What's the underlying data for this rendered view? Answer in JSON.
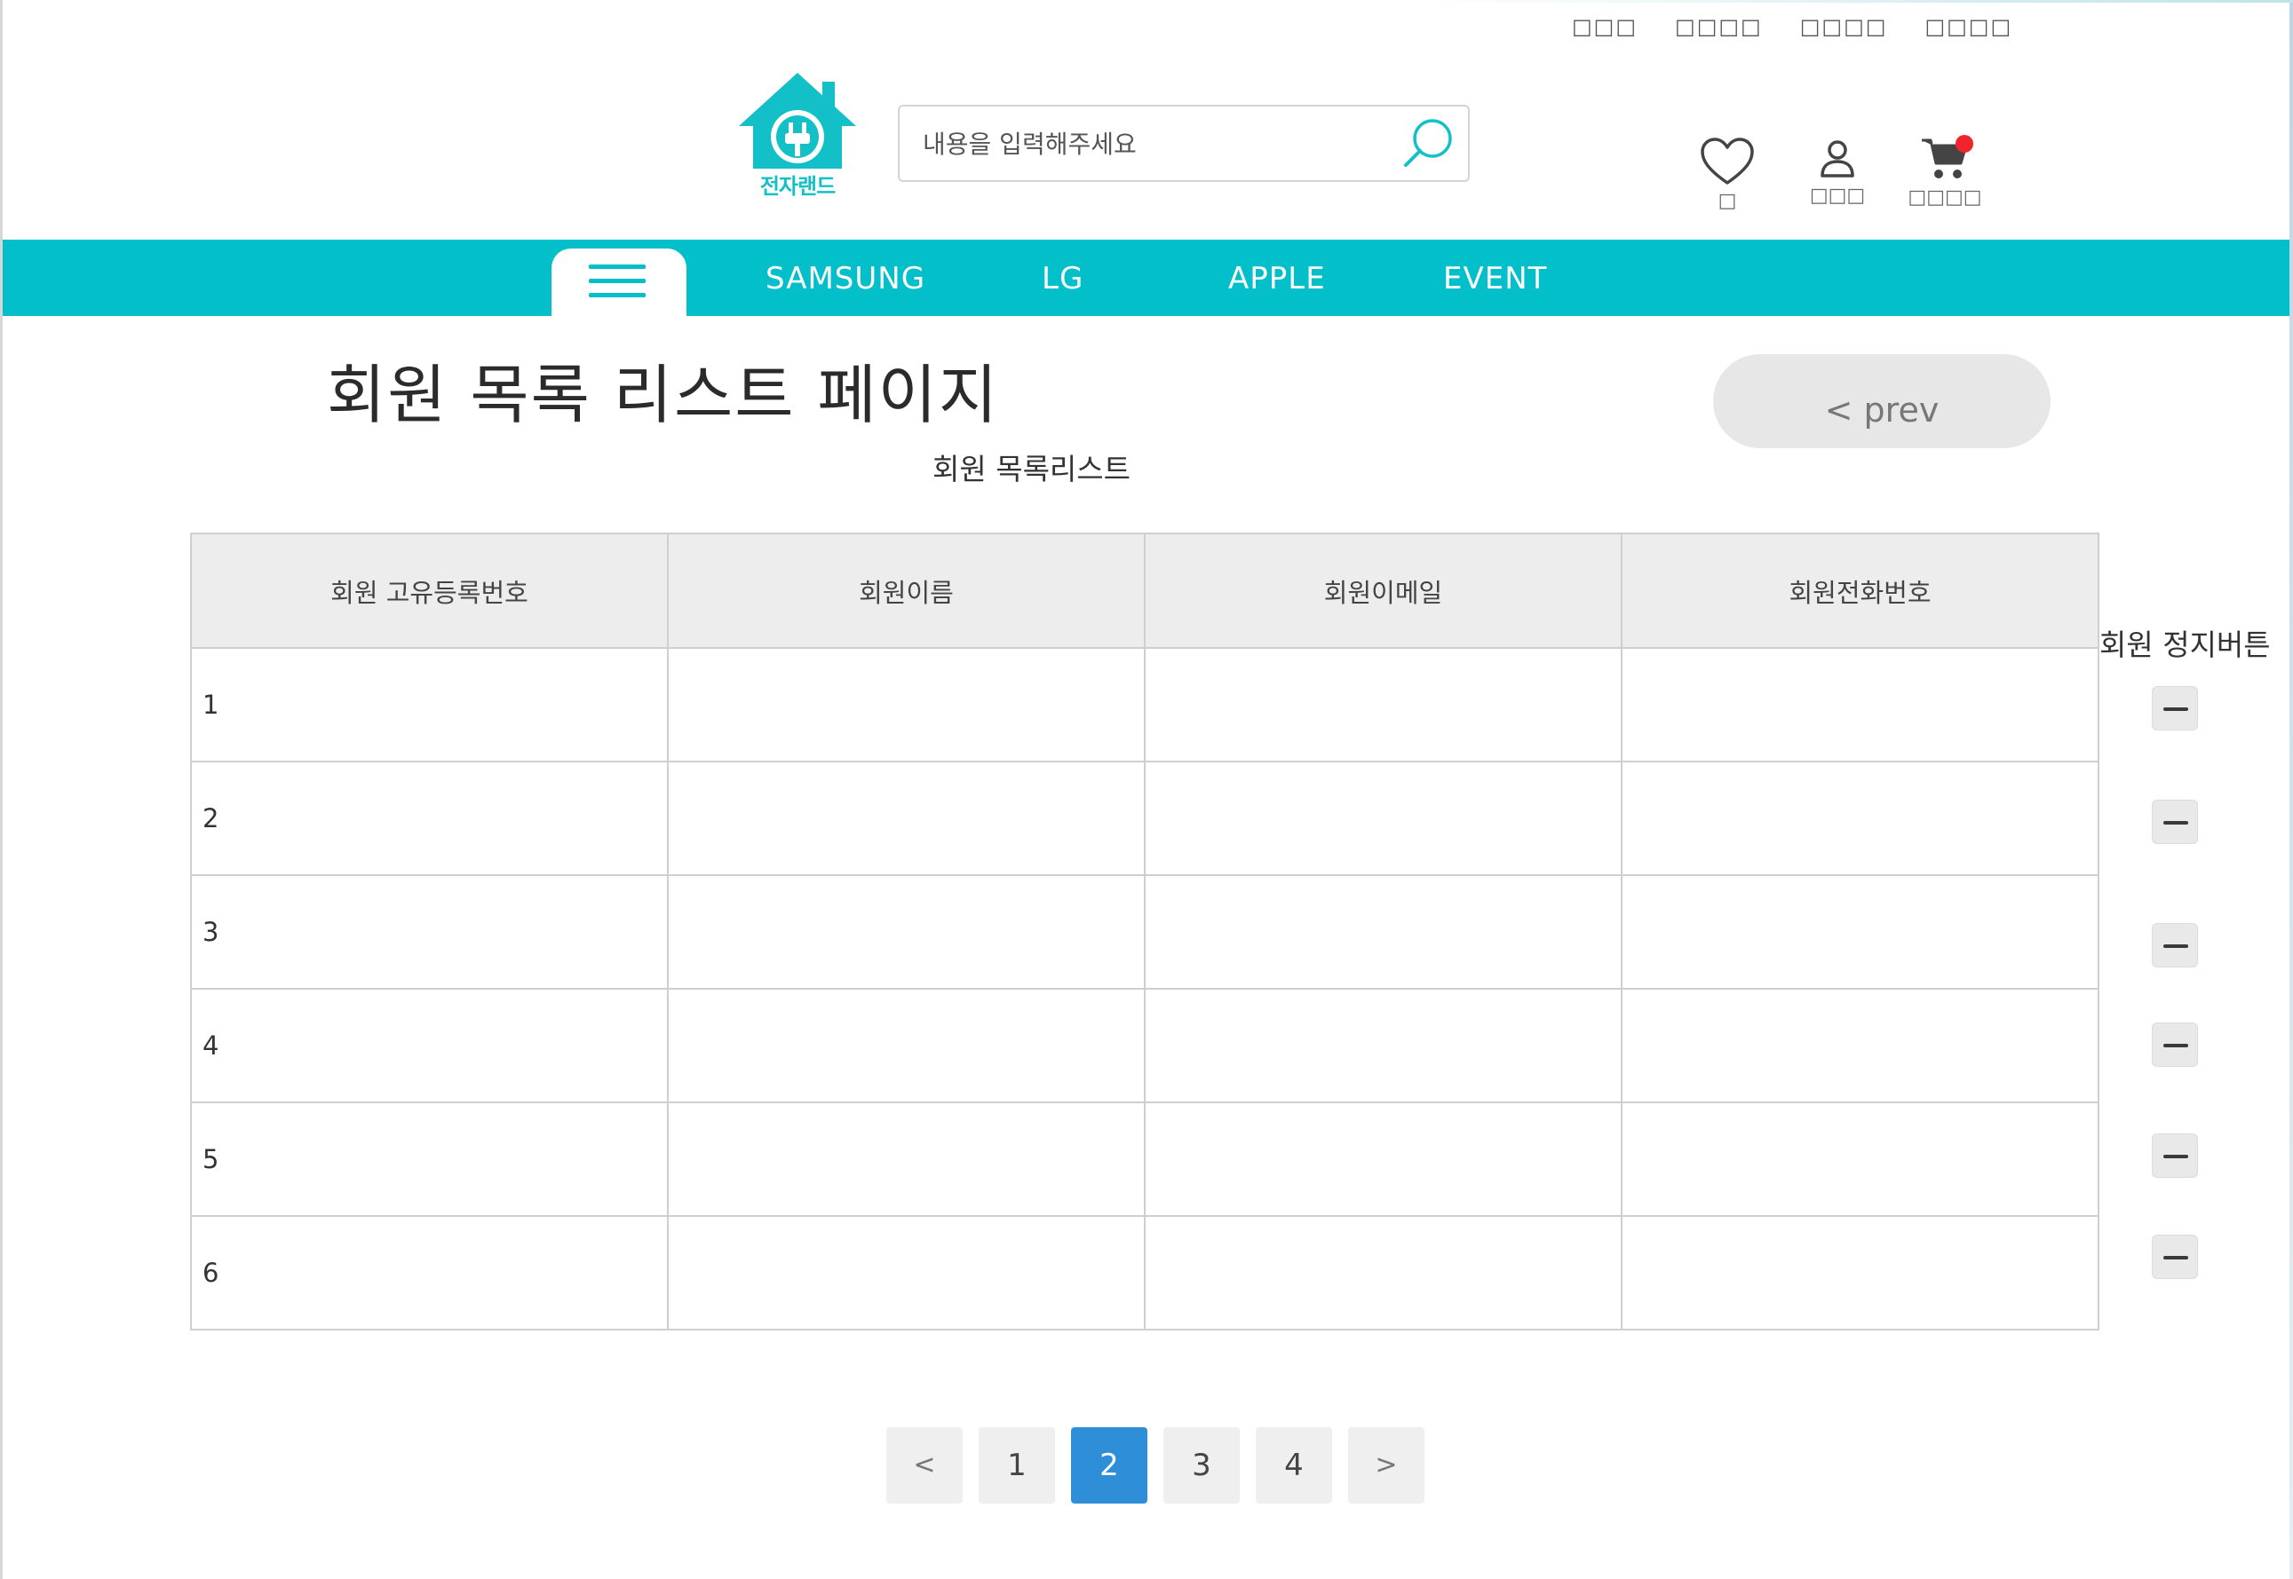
{
  "util_links": [
    "□□□",
    "□□□□",
    "□□□□",
    "□□□□"
  ],
  "logo": {
    "text": "전자랜드"
  },
  "search": {
    "placeholder": "내용을 입력해주세요"
  },
  "header_icons": {
    "wish_label": "□",
    "mypage_label": "□□□",
    "cart_label": "□□□□"
  },
  "nav": {
    "items": [
      "SAMSUNG",
      "LG",
      "APPLE",
      "EVENT"
    ]
  },
  "page": {
    "title": "회원 목록 리스트 페이지",
    "subtitle": "회원 목록리스트",
    "prev_label": "< prev"
  },
  "table": {
    "headers": [
      "회원 고유등록번호",
      "회원이름",
      "회원이메일",
      "회원전화번호"
    ],
    "rows": [
      [
        "1",
        "",
        "",
        ""
      ],
      [
        "2",
        "",
        "",
        ""
      ],
      [
        "3",
        "",
        "",
        ""
      ],
      [
        "4",
        "",
        "",
        ""
      ],
      [
        "5",
        "",
        "",
        ""
      ],
      [
        "6",
        "",
        "",
        ""
      ]
    ]
  },
  "suspend": {
    "label": "회원 정지버튼"
  },
  "pagination": {
    "prev": "<",
    "pages": [
      "1",
      "2",
      "3",
      "4"
    ],
    "current": "2",
    "next": ">"
  },
  "colors": {
    "brand": "#02bfc9",
    "active_page": "#2e8fd8",
    "cart_badge": "#f0242d"
  }
}
